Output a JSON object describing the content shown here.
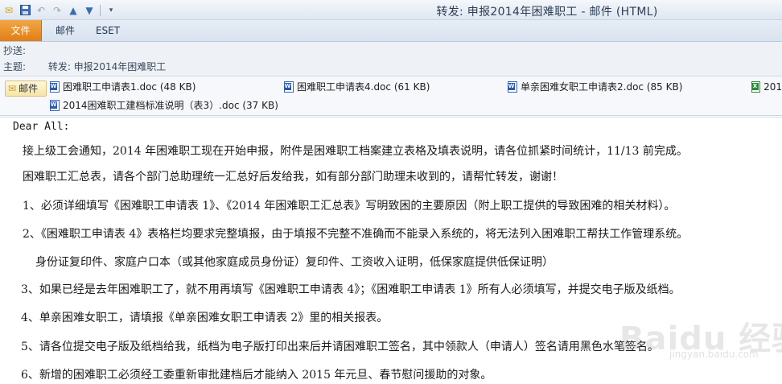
{
  "window": {
    "title": "转发: 申报2014年困难职工 - 邮件 (HTML)"
  },
  "quick_access": {
    "icons": [
      "mail-icon",
      "save-icon",
      "undo-icon",
      "redo-icon",
      "up-arrow-icon",
      "down-arrow-icon",
      "customize-icon"
    ]
  },
  "ribbon": {
    "tabs": [
      {
        "label": "文件",
        "active": true
      },
      {
        "label": "邮件"
      },
      {
        "label": "ESET"
      }
    ],
    "file_tab_color": "#e8891f"
  },
  "header": {
    "cc_label": "抄送:",
    "cc_value": "",
    "subject_label": "主题:",
    "subject_value": "转发: 申报2014年困难职工"
  },
  "attachments": {
    "message_tab": "邮件",
    "files": [
      {
        "name": "困难职工申请表1.doc (48 KB)",
        "type": "doc"
      },
      {
        "name": "困难职工申请表4.doc (61 KB)",
        "type": "doc"
      },
      {
        "name": "单亲困难女职工申请表2.doc (85 KB)",
        "type": "doc"
      },
      {
        "name": "201",
        "type": "xls"
      },
      {
        "name": "2014困难职工建档标准说明（表3）.doc (37 KB)",
        "type": "doc"
      }
    ]
  },
  "body": {
    "greeting": "Dear All:",
    "paragraphs": [
      "接上级工会通知，2014 年困难职工现在开始申报，附件是困难职工档案建立表格及填表说明，请各位抓紧时间统计，11/13 前完成。",
      "困难职工汇总表，请各个部门总助理统一汇总好后发给我，如有部分部门助理未收到的，请帮忙转发，谢谢！",
      "1、必须详细填写《困难职工申请表 1》、《2014 年困难职工汇总表》写明致困的主要原因（附上职工提供的导致困难的相关材料）。",
      "2、《困难职工申请表 4》表格栏均要求完整填报，由于填报不完整不准确而不能录入系统的，将无法列入困难职工帮扶工作管理系统。",
      "身份证复印件、家庭户口本（或其他家庭成员身份证）复印件、工资收入证明，低保家庭提供低保证明）",
      "3、如果已经是去年困难职工了，就不用再填写《困难职工申请表 4》；《困难职工申请表 1》所有人必须填写，并提交电子版及纸档。",
      "4、单亲困难女职工，请填报《单亲困难女职工申请表 2》里的相关报表。",
      "5、请各位提交电子版及纸档给我，纸档为电子版打印出来后并请困难职工签名，其中领款人（申请人）签名请用黑色水笔签名。",
      "6、新增的困难职工必须经工委重新审批建档后才能纳入 2015 年元旦、春节慰问援助的对象。"
    ]
  },
  "watermark": {
    "text": "Baidu 经验",
    "sub": "jingyan.baidu.com"
  }
}
